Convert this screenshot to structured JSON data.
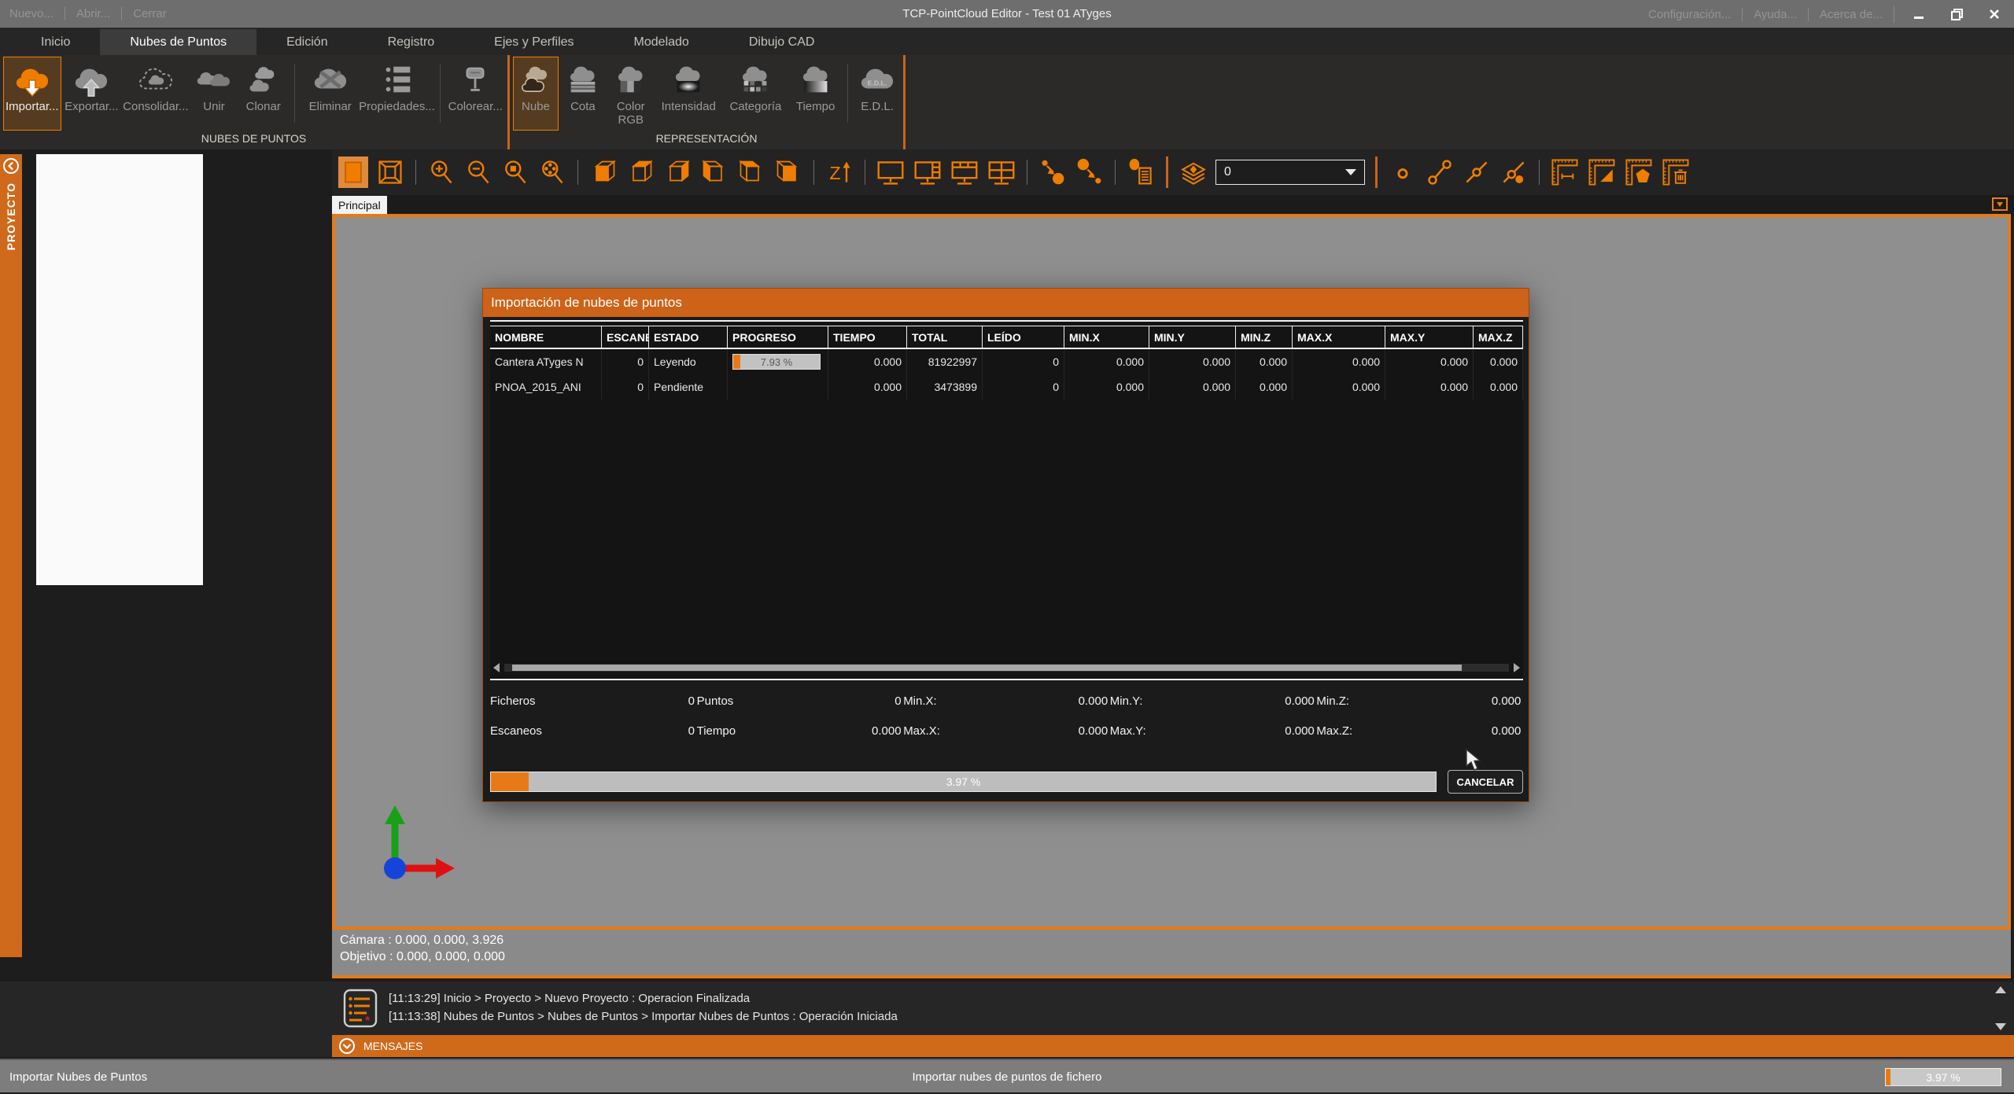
{
  "titlebar": {
    "title": "TCP-PointCloud Editor - Test 01 ATyges",
    "left_menu": [
      "Nuevo...",
      "Abrir...",
      "Cerrar"
    ],
    "right_menu": [
      "Configuración...",
      "Ayuda...",
      "Acerca de..."
    ]
  },
  "menubar": {
    "tabs": [
      "Inicio",
      "Nubes de Puntos",
      "Edición",
      "Registro",
      "Ejes y Perfiles",
      "Modelado",
      "Dibujo CAD"
    ],
    "active_tab": "Nubes de Puntos"
  },
  "ribbon": {
    "groups": [
      {
        "label": "NUBES DE PUNTOS",
        "buttons": [
          {
            "label": "Importar..."
          },
          {
            "label": "Exportar..."
          },
          {
            "label": "Consolidar..."
          },
          {
            "label": "Unir"
          },
          {
            "label": "Clonar"
          },
          {
            "label": "Eliminar"
          },
          {
            "label": "Propiedades..."
          },
          {
            "label": "Colorear..."
          }
        ]
      },
      {
        "label": "REPRESENTACIÓN",
        "buttons": [
          {
            "label": "Nube"
          },
          {
            "label": "Cota"
          },
          {
            "label": "Color RGB"
          },
          {
            "label": "Intensidad"
          },
          {
            "label": "Categoría"
          },
          {
            "label": "Tiempo"
          },
          {
            "label": "E.D.L."
          }
        ]
      }
    ]
  },
  "toolbar": {
    "layer_value": "0"
  },
  "sidebar": {
    "label": "PROYECTO"
  },
  "viewport": {
    "tab": "Principal",
    "camera_line1": "Cámara : 0.000, 0.000, 3.926",
    "camera_line2": "Objetivo : 0.000, 0.000, 0.000"
  },
  "dialog": {
    "title": "Importación de nubes de puntos",
    "columns": [
      "NOMBRE",
      "ESCANEOS",
      "ESTADO",
      "PROGRESO",
      "TIEMPO",
      "TOTAL",
      "LEÍDO",
      "MIN.X",
      "MIN.Y",
      "MIN.Z",
      "MAX.X",
      "MAX.Y",
      "MAX.Z"
    ],
    "rows": [
      {
        "nombre": "Cantera ATyges N",
        "escaneos": "0",
        "estado": "Leyendo",
        "progreso_label": "7.93 %",
        "progreso_pct": 7.93,
        "tiempo": "0.000",
        "total": "81922997",
        "leido": "0",
        "min_x": "0.000",
        "min_y": "0.000",
        "min_z": "0.000",
        "max_x": "0.000",
        "max_y": "0.000",
        "max_z": "0.000"
      },
      {
        "nombre": "PNOA_2015_ANI",
        "escaneos": "0",
        "estado": "Pendiente",
        "progreso_label": "",
        "progreso_pct": 0,
        "tiempo": "0.000",
        "total": "3473899",
        "leido": "0",
        "min_x": "0.000",
        "min_y": "0.000",
        "min_z": "0.000",
        "max_x": "0.000",
        "max_y": "0.000",
        "max_z": "0.000"
      }
    ],
    "stats": {
      "row1": [
        {
          "label": "Ficheros",
          "value": "0"
        },
        {
          "label": "Puntos",
          "value": "0"
        },
        {
          "label": "Min.X:",
          "value": "0.000"
        },
        {
          "label": "Min.Y:",
          "value": "0.000"
        },
        {
          "label": "Min.Z:",
          "value": "0.000"
        }
      ],
      "row2": [
        {
          "label": "Escaneos",
          "value": "0"
        },
        {
          "label": "Tiempo",
          "value": "0.000"
        },
        {
          "label": "Max.X:",
          "value": "0.000"
        },
        {
          "label": "Max.Y:",
          "value": "0.000"
        },
        {
          "label": "Max.Z:",
          "value": "0.000"
        }
      ]
    },
    "progress": {
      "label": "3.97 %",
      "pct": 3.97
    },
    "cancel_label": "CANCELAR"
  },
  "log": {
    "messages": [
      "[11:13:29] Inicio > Proyecto > Nuevo Proyecto : Operacion Finalizada",
      "[11:13:38] Nubes de Puntos > Nubes de Puntos > Importar Nubes de Puntos : Operación Iniciada"
    ]
  },
  "mensajes": {
    "label": "MENSAJES"
  },
  "statusbar": {
    "left": "Importar Nubes de Puntos",
    "center": "Importar nubes de puntos de fichero",
    "progress": {
      "label": "3.97 %",
      "pct": 3.97
    }
  },
  "colors": {
    "accent": "#E8790F",
    "axis_x": "#e01010",
    "axis_y": "#18a018",
    "axis_z": "#1545d8"
  }
}
